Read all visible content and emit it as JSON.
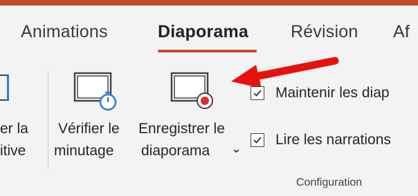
{
  "tabs": [
    {
      "label": "Animations"
    },
    {
      "label": "Diaporama",
      "active": true
    },
    {
      "label": "Révision"
    },
    {
      "label": "Af"
    }
  ],
  "ribbon": {
    "truncated_button": {
      "line1": "er la",
      "line2": "itive"
    },
    "verify_timing": {
      "line1": "Vérifier le",
      "line2": "minutage"
    },
    "record_slideshow": {
      "line1": "Enregistrer le",
      "line2": "diaporama",
      "dropdown_glyph": "⌄"
    },
    "checkboxes": [
      {
        "label": "Maintenir les diap",
        "checked": true
      },
      {
        "label": "Lire les narrations",
        "checked": true
      }
    ],
    "group_label": "Configuration"
  },
  "colors": {
    "accent": "#c34a2b",
    "annotation_arrow": "#e8120c",
    "icon_blue": "#2f7bd1",
    "record_red": "#e12a2a"
  },
  "icons": [
    "timer-screen-icon",
    "record-screen-icon",
    "checkmark-icon",
    "annotation-arrow"
  ]
}
